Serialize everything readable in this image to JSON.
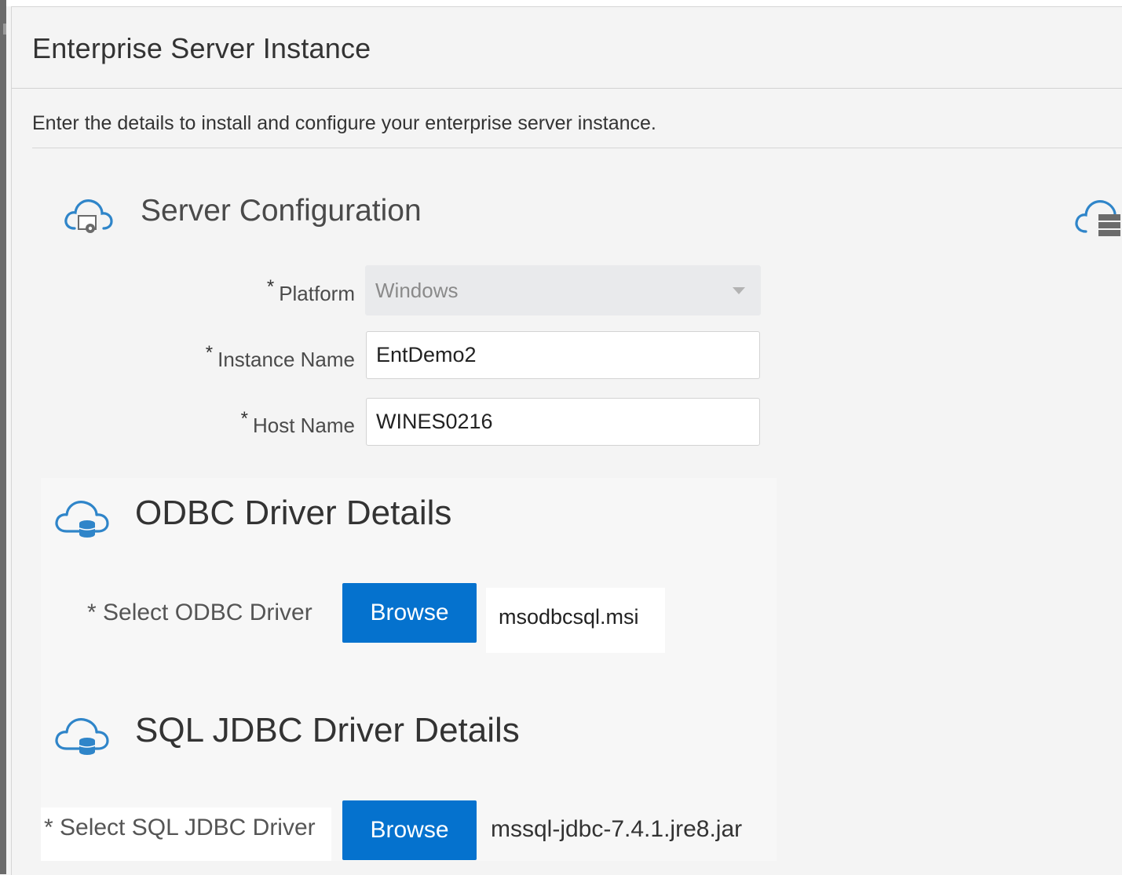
{
  "dialog": {
    "title": "Enterprise Server Instance",
    "intro": "Enter the details to install and configure your enterprise server instance."
  },
  "server_configuration": {
    "title": "Server Configuration",
    "icon": "cloud-gear-icon",
    "platform": {
      "required": "*",
      "label": "Platform",
      "value": "Windows",
      "disabled": true
    },
    "instance_name": {
      "required": "*",
      "label": "Instance Name",
      "value": "EntDemo2"
    },
    "host_name": {
      "required": "*",
      "label": "Host Name",
      "value": "WINES0216"
    }
  },
  "odbc": {
    "title": "ODBC Driver Details",
    "icon": "cloud-database-icon",
    "label": "* Select ODBC Driver",
    "browse_label": "Browse",
    "file_name": "msodbcsql.msi"
  },
  "jdbc": {
    "title": "SQL JDBC Driver Details",
    "icon": "cloud-database-icon",
    "label": "* Select SQL JDBC Driver",
    "browse_label": "Browse",
    "file_name": "mssql-jdbc-7.4.1.jre8.jar"
  },
  "colors": {
    "accent": "#0572ce",
    "icon": "#2f85c9"
  }
}
